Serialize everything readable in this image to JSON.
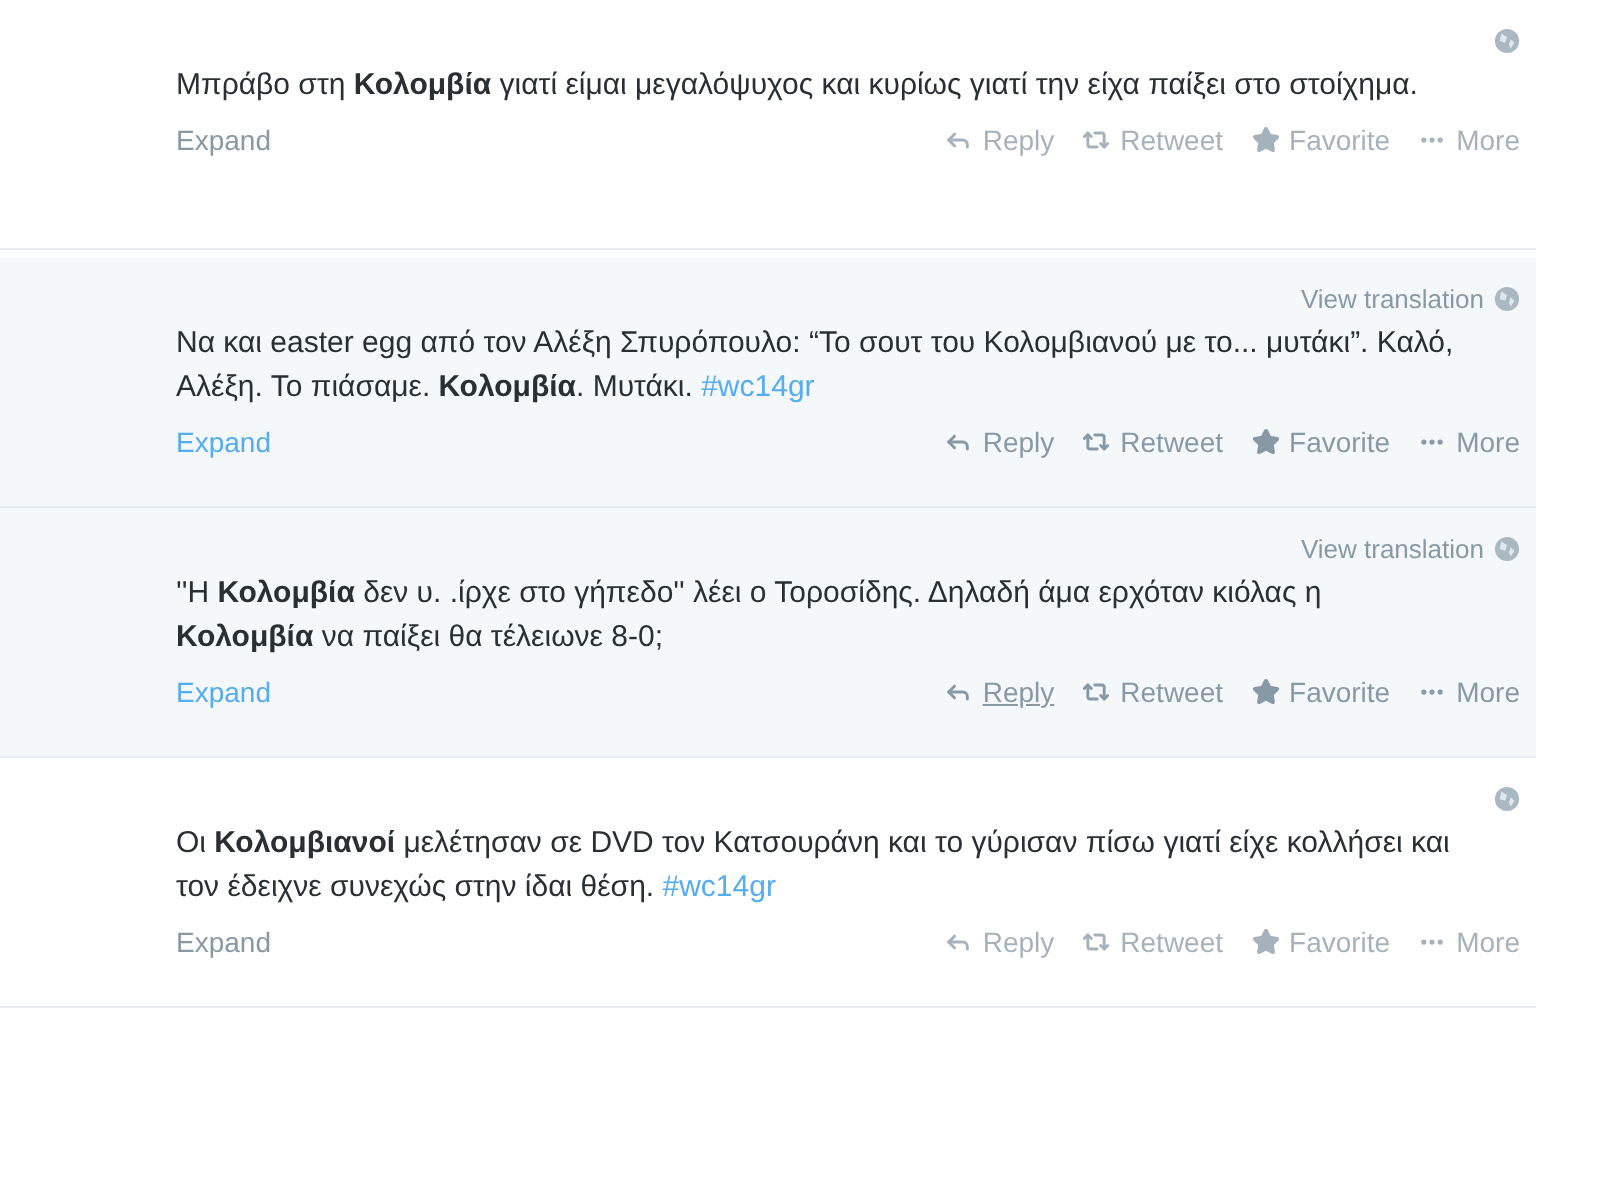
{
  "tweets": [
    {
      "active": false,
      "segments": [
        {
          "kind": "plain",
          "text": "Μπράβο στη "
        },
        {
          "kind": "bold",
          "text": "Κολομβία"
        },
        {
          "kind": "plain",
          "text": " γιατί είμαι μεγαλόψυχος και κυρίως γιατί την είχα παίξει στο στοίχημα."
        }
      ],
      "expand": "Expand",
      "actions": [
        {
          "kind": "reply",
          "label": "Reply",
          "hovered": false
        },
        {
          "kind": "retweet",
          "label": "Retweet",
          "hovered": false
        },
        {
          "kind": "favorite",
          "label": "Favorite",
          "hovered": false
        },
        {
          "kind": "more",
          "label": "More",
          "hovered": false
        }
      ]
    },
    {
      "active": true,
      "translation": "View translation",
      "segments": [
        {
          "kind": "plain",
          "text": "Να και easter egg από τον Αλέξη Σπυρόπουλο: “Το σουτ του Κολομβιανού με το... μυτάκι”. Καλό, Αλέξη. Το πιάσαμε. "
        },
        {
          "kind": "bold",
          "text": "Κολομβία"
        },
        {
          "kind": "plain",
          "text": ". Μυτάκι. "
        },
        {
          "kind": "hashtag",
          "text": "#wc14gr"
        }
      ],
      "expand": "Expand",
      "actions": [
        {
          "kind": "reply",
          "label": "Reply",
          "hovered": false
        },
        {
          "kind": "retweet",
          "label": "Retweet",
          "hovered": false
        },
        {
          "kind": "favorite",
          "label": "Favorite",
          "hovered": false
        },
        {
          "kind": "more",
          "label": "More",
          "hovered": false
        }
      ]
    },
    {
      "active": true,
      "translation": "View translation",
      "segments": [
        {
          "kind": "plain",
          "text": "''Η "
        },
        {
          "kind": "bold",
          "text": "Κολομβία"
        },
        {
          "kind": "plain",
          "text": " δεν υ. .ίρχε στο γήπεδο'' λέει ο Τοροσίδης. Δηλαδή άμα ερχόταν κιόλας η "
        },
        {
          "kind": "bold",
          "text": "Κολομβία"
        },
        {
          "kind": "plain",
          "text": " να παίξει θα τέλειωνε 8-0;"
        }
      ],
      "expand": "Expand",
      "actions": [
        {
          "kind": "reply",
          "label": "Reply",
          "hovered": true
        },
        {
          "kind": "retweet",
          "label": "Retweet",
          "hovered": false
        },
        {
          "kind": "favorite",
          "label": "Favorite",
          "hovered": false
        },
        {
          "kind": "more",
          "label": "More",
          "hovered": false
        }
      ]
    },
    {
      "active": false,
      "segments": [
        {
          "kind": "plain",
          "text": "Οι "
        },
        {
          "kind": "bold",
          "text": "Κολομβιανοί"
        },
        {
          "kind": "plain",
          "text": " μελέτησαν σε DVD τον Κατσουράνη και το γύρισαν πίσω γιατί είχε κολλήσει και τον έδειχνε συνεχώς στην ίδαι θέση. "
        },
        {
          "kind": "hashtag",
          "text": "#wc14gr"
        }
      ],
      "expand": "Expand",
      "actions": [
        {
          "kind": "reply",
          "label": "Reply",
          "hovered": false
        },
        {
          "kind": "retweet",
          "label": "Retweet",
          "hovered": false
        },
        {
          "kind": "favorite",
          "label": "Favorite",
          "hovered": false
        },
        {
          "kind": "more",
          "label": "More",
          "hovered": false
        }
      ]
    }
  ]
}
